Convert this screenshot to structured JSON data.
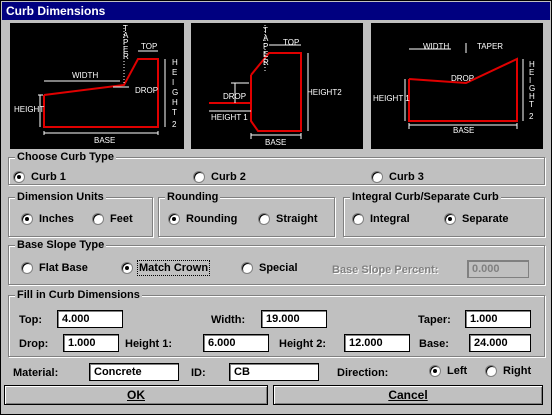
{
  "window": {
    "title": "Curb Dimensions"
  },
  "diagrams": {
    "curb1": {
      "taper": "TAPER",
      "top": "TOP",
      "width": "WIDTH",
      "drop": "DROP",
      "height": "HEIGHT",
      "height_right": "HEIGHT",
      "base": "BASE"
    },
    "curb2": {
      "taper": "TAPER",
      "top": "TOP",
      "drop": "DROP",
      "height2": "HEIGHT2",
      "height1": "HEIGHT 1",
      "base": "BASE"
    },
    "curb3": {
      "width": "WIDTH",
      "taper": "TAPER",
      "drop": "DROP",
      "height1": "HEIGHT 1",
      "height_right": "HEIGHT 2",
      "base": "BASE"
    }
  },
  "curb_type": {
    "title": "Choose Curb Type",
    "options": [
      {
        "label": "Curb 1",
        "selected": true
      },
      {
        "label": "Curb 2",
        "selected": false
      },
      {
        "label": "Curb 3",
        "selected": false
      }
    ]
  },
  "units": {
    "title": "Dimension Units",
    "options": [
      {
        "label": "Inches",
        "selected": true
      },
      {
        "label": "Feet",
        "selected": false
      }
    ]
  },
  "rounding": {
    "title": "Rounding",
    "options": [
      {
        "label": "Rounding",
        "selected": true
      },
      {
        "label": "Straight",
        "selected": false
      }
    ]
  },
  "integral": {
    "title": "Integral Curb/Separate Curb",
    "options": [
      {
        "label": "Integral",
        "selected": false
      },
      {
        "label": "Separate",
        "selected": true
      }
    ]
  },
  "base_slope": {
    "title": "Base Slope Type",
    "options": [
      {
        "label": "Flat Base",
        "selected": false
      },
      {
        "label": "Match Crown",
        "selected": true
      },
      {
        "label": "Special",
        "selected": false
      }
    ],
    "percent_label": "Base Slope Percent:",
    "percent_value": "0.000"
  },
  "dims": {
    "title": "Fill in Curb Dimensions",
    "top_label": "Top:",
    "top_value": "4.000",
    "width_label": "Width:",
    "width_value": "19.000",
    "taper_label": "Taper:",
    "taper_value": "1.000",
    "drop_label": "Drop:",
    "drop_value": "1.000",
    "height1_label": "Height 1:",
    "height1_value": "6.000",
    "height2_label": "Height 2:",
    "height2_value": "12.000",
    "base_label": "Base:",
    "base_value": "24.000"
  },
  "material": {
    "label": "Material:",
    "value": "Concrete"
  },
  "id_field": {
    "label": "ID:",
    "value": "CB"
  },
  "direction": {
    "label": "Direction:",
    "options": [
      {
        "label": "Left",
        "selected": true
      },
      {
        "label": "Right",
        "selected": false
      }
    ]
  },
  "buttons": {
    "ok": "OK",
    "cancel": "Cancel"
  }
}
